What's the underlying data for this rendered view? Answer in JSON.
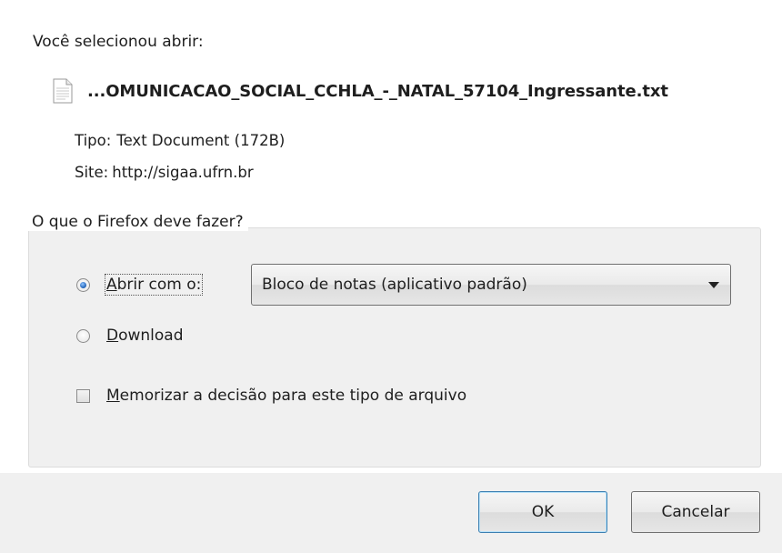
{
  "dialog": {
    "selected_label": "Você selecionou abrir:",
    "file_name": "...OMUNICACAO_SOCIAL_CCHLA_-_NATAL_57104_Ingressante.txt",
    "file_icon": "text-document-icon",
    "type_label": "Tipo:",
    "type_value": "Text Document (172B)",
    "site_label": "Site:",
    "site_value": "http://sigaa.ufrn.br"
  },
  "action_group": {
    "legend": "O que o Firefox deve fazer?",
    "open_with": {
      "mnemonic": "A",
      "label_rest": "brir com o:",
      "checked": true
    },
    "application_select": {
      "value": "Bloco de notas (aplicativo padrão)"
    },
    "download": {
      "mnemonic": "D",
      "label_rest": "ownload",
      "checked": false
    },
    "remember": {
      "mnemonic": "M",
      "label_rest": "emorizar a decisão para este tipo de arquivo",
      "checked": false
    }
  },
  "buttons": {
    "ok": "OK",
    "cancel": "Cancelar"
  },
  "colors": {
    "background": "#ffffff",
    "footer": "#f0f0f0",
    "default_button_border": "#3c7fb1"
  }
}
